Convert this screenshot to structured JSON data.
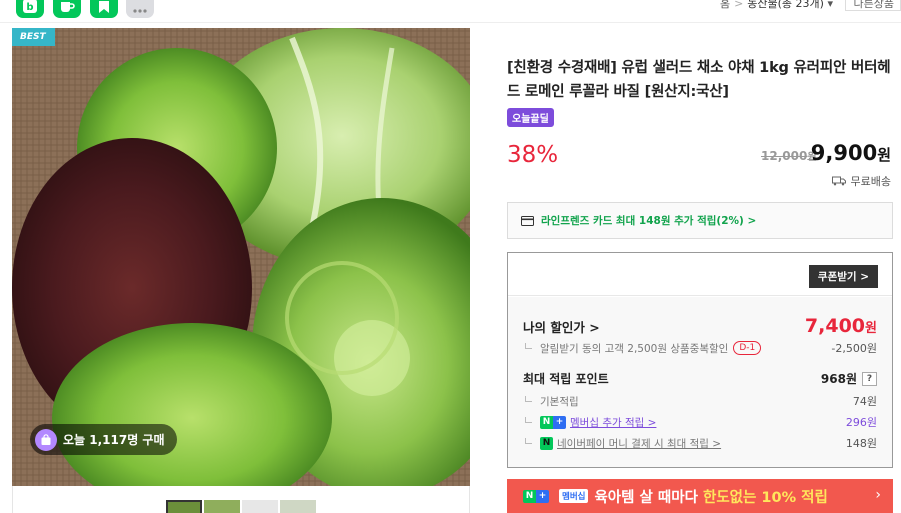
{
  "top": {
    "share_icons": [
      "blog-icon",
      "cafe-icon",
      "bookmark-icon",
      "more-icon"
    ],
    "breadcrumb": [
      "홈",
      "농산물(총 23개)"
    ],
    "prev_button": "다른상품"
  },
  "image": {
    "badge": "BEST",
    "today_purchase": "오늘 1,117명 구매"
  },
  "product": {
    "title": "[친환경 수경재배] 유럽 샐러드 채소 야채 1kg 유러피안 버터헤드 로메인 루꼴라 바질 [원산지:국산]",
    "deal_badge": "오늘끝딜",
    "discount_rate": "38%",
    "original_price": "12,000",
    "original_price_unit": "원",
    "sale_price": "9,900",
    "price_unit": "원",
    "shipping": "무료배송"
  },
  "card_promo": "라인프렌즈 카드 최대 148원 추가 적립(2%) >",
  "benefit": {
    "coupon_button": "쿠폰받기 >",
    "my_price_label": "나의 할인가 >",
    "my_price": "7,400",
    "my_price_unit": "원",
    "alarm_label": "알림받기 동의 고객 2,500원 상품중복할인",
    "d_badge": "D-1",
    "alarm_value": "-2,500원",
    "max_points_label": "최대 적립 포인트",
    "max_points": "968원",
    "help": "?",
    "basic_label": "기본적립",
    "basic_value": "74원",
    "membership_label": "멤버십 추가 적립 >",
    "membership_value": "296원",
    "npay_label": "네이버페이 머니 결제 시 최대 적립 >",
    "npay_value": "148원"
  },
  "promo_banner": {
    "membership_tag": "멤버십",
    "text_before": "육아템 살 때마다 ",
    "text_highlight": "한도없는 10% 적립",
    "arrow": "›"
  },
  "colors": {
    "naver_green": "#03c75a",
    "sale_red": "#e8263b",
    "deal_purple": "#7d4cdb",
    "banner_red": "#f2584e",
    "best_teal": "#35b6c8"
  }
}
